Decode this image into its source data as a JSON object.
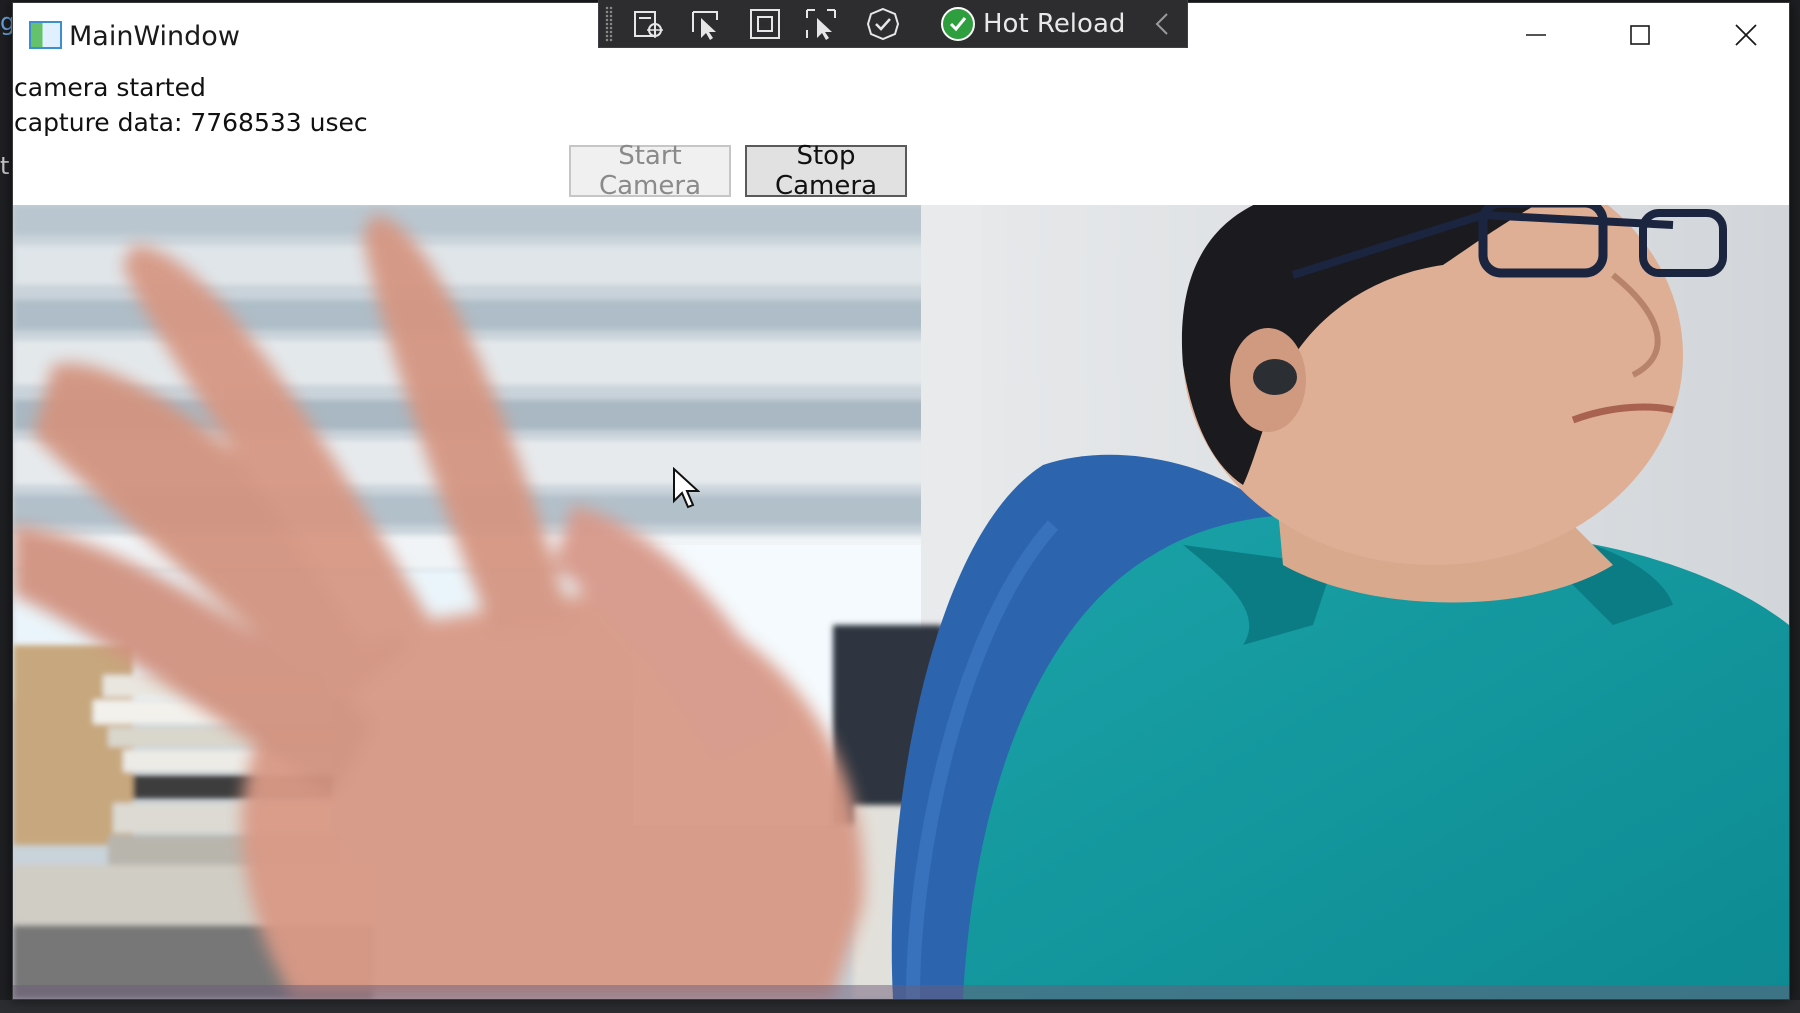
{
  "window": {
    "title": "MainWindow",
    "controls": [
      "minimize",
      "maximize",
      "close"
    ]
  },
  "debug_toolbar": {
    "icons": [
      "live-visual-tree-icon",
      "select-element-icon",
      "display-layout-adorners-icon",
      "track-focused-element-icon",
      "binding-failures-icon"
    ],
    "hot_reload_label": "Hot Reload",
    "hot_reload_status_color": "#2e9e3e"
  },
  "status": {
    "message": "camera started",
    "capture": "capture data: 7768533 usec"
  },
  "buttons": {
    "start_label": "Start Camera",
    "start_enabled": false,
    "stop_label": "Stop Camera",
    "stop_enabled": true
  },
  "camera_preview": {
    "content": "live-webcam-feed"
  }
}
